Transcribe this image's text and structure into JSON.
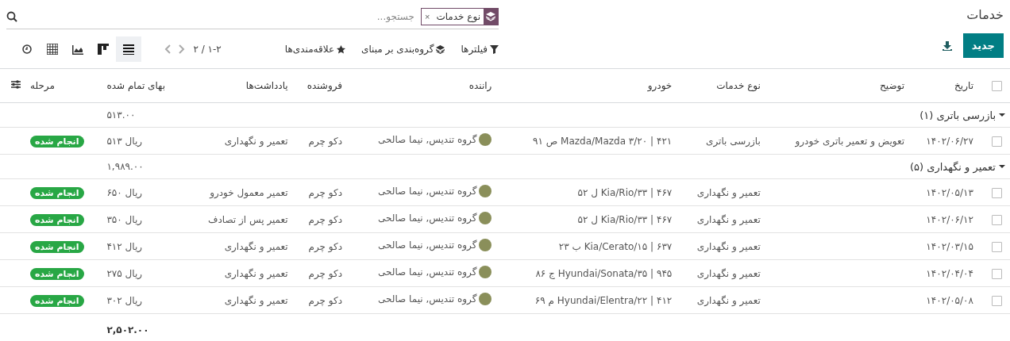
{
  "title": "خدمات",
  "new_button": "جدید",
  "select_all": {
    "checked": false
  },
  "search": {
    "facets": [
      {
        "label": "نوع خدمات",
        "remove": "×"
      }
    ],
    "placeholder": "جستجو..."
  },
  "toolbar": {
    "filters": "فیلترها",
    "group_by": "گروه‌بندی بر مبنای",
    "favorites": "علاقه‌مندی‌ها"
  },
  "pager": "۱-۲ / ۲",
  "views": [
    {
      "kind": "list",
      "selected": true
    },
    {
      "kind": "kanban",
      "selected": false
    },
    {
      "kind": "graph",
      "selected": false
    },
    {
      "kind": "pivot",
      "selected": false
    },
    {
      "kind": "activity",
      "selected": false
    }
  ],
  "columns": [
    "تاریخ",
    "توضیح",
    "نوع خدمات",
    "خودرو",
    "راننده",
    "فروشنده",
    "یادداشت‌ها",
    "بهای تمام شده",
    "مرحله"
  ],
  "groups": [
    {
      "label": "بازرسی باتری (۱)",
      "expanded": true,
      "subtotal": "۵۱۳.۰۰",
      "rows": [
        {
          "checked": false,
          "date": "۱۴۰۲/۰۶/۲۷",
          "description": "تعویض و تعمیر باتری خودرو",
          "service_type": "بازرسی باتری",
          "vehicle": "۴۲۱ | Mazda/Mazda ۳/۲۰ ص ۹۱",
          "driver": "گروه تندیس, نیما صالحی",
          "vendor": "دکو چرم",
          "notes": "تعمیر و نگهداری",
          "cost": "ریال ۵۱۳",
          "stage": "انجام شده"
        }
      ]
    },
    {
      "label": "تعمیر و نگهداری (۵)",
      "expanded": true,
      "subtotal": "۱,۹۸۹.۰۰",
      "rows": [
        {
          "checked": false,
          "date": "۱۴۰۲/۰۵/۱۳",
          "service_type": "تعمیر و نگهداری",
          "vehicle": "۴۶۷ | Kia/Rio/۳۳ ل ۵۲",
          "driver": "گروه تندیس, نیما صالحی",
          "vendor": "دکو چرم",
          "notes": "تعمیر معمول خودرو",
          "cost": "ریال ۶۵۰",
          "stage": "انجام شده"
        },
        {
          "checked": false,
          "date": "۱۴۰۲/۰۶/۱۲",
          "service_type": "تعمیر و نگهداری",
          "vehicle": "۴۶۷ | Kia/Rio/۳۳ ل ۵۲",
          "driver": "گروه تندیس, نیما صالحی",
          "vendor": "دکو چرم",
          "notes": "تعمیر پس از تصادف",
          "cost": "ریال ۳۵۰",
          "stage": "انجام شده"
        },
        {
          "checked": false,
          "date": "۱۴۰۲/۰۳/۱۵",
          "service_type": "تعمیر و نگهداری",
          "vehicle": "۶۳۷ | Kia/Cerato/۱۵ ب ۲۳",
          "driver": "گروه تندیس, نیما صالحی",
          "vendor": "دکو چرم",
          "notes": "تعمیر و نگهداری",
          "cost": "ریال ۴۱۲",
          "stage": "انجام شده"
        },
        {
          "checked": false,
          "date": "۱۴۰۲/۰۴/۰۴",
          "service_type": "تعمیر و نگهداری",
          "vehicle": "۹۴۵ | Hyundai/Sonata/۳۵ ج ۸۶",
          "driver": "گروه تندیس, نیما صالحی",
          "vendor": "دکو چرم",
          "notes": "تعمیر و نگهداری",
          "cost": "ریال ۲۷۵",
          "stage": "انجام شده"
        },
        {
          "checked": false,
          "date": "۱۴۰۲/۰۵/۰۸",
          "service_type": "تعمیر و نگهداری",
          "vehicle": "۴۱۲ | Hyundai/Elentra/۲۲ م ۶۹",
          "driver": "گروه تندیس, نیما صالحی",
          "vendor": "دکو چرم",
          "notes": "تعمیر و نگهداری",
          "cost": "ریال ۳۰۲",
          "stage": "انجام شده"
        }
      ]
    }
  ],
  "total": "۲,۵۰۲.۰۰"
}
